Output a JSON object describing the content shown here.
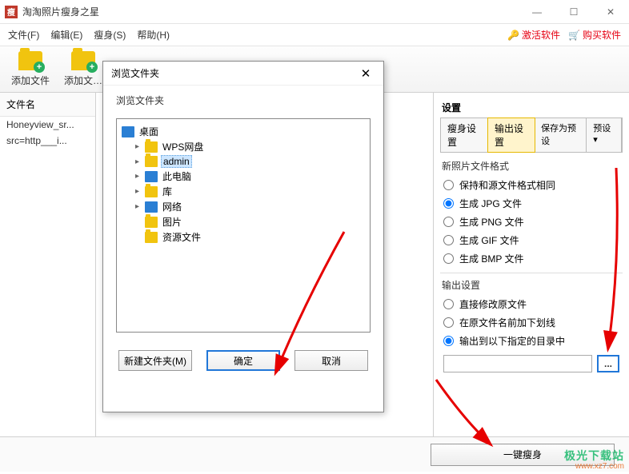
{
  "window": {
    "title": "淘淘照片瘦身之星"
  },
  "win_controls": {
    "min": "—",
    "max": "☐",
    "close": "✕"
  },
  "menu": {
    "file": "文件(F)",
    "edit": "编辑(E)",
    "slim": "瘦身(S)",
    "help": "帮助(H)",
    "activate": "激活软件",
    "buy": "购买软件"
  },
  "toolbar": {
    "add_file": "添加文件",
    "add_folder": "添加文…"
  },
  "file_list": {
    "header": "文件名",
    "items": [
      "Honeyview_sr...",
      "src=http___i..."
    ]
  },
  "settings": {
    "title": "设置",
    "tabs": {
      "slim": "瘦身设置",
      "output": "输出设置",
      "save_preset": "保存为预设",
      "preset": "预设 ▾"
    },
    "format_group": "新照片文件格式",
    "format_opts": {
      "same": "保持和源文件格式相同",
      "jpg": "生成 JPG 文件",
      "png": "生成 PNG 文件",
      "gif": "生成 GIF 文件",
      "bmp": "生成 BMP 文件"
    },
    "output_group": "输出设置",
    "output_opts": {
      "overwrite": "直接修改原文件",
      "underscore": "在原文件名前加下划线",
      "todir": "输出到以下指定的目录中"
    },
    "path_value": "",
    "browse_label": "..."
  },
  "bottom": {
    "run": "一键瘦身"
  },
  "dialog": {
    "title": "浏览文件夹",
    "subtitle": "浏览文件夹",
    "tree": {
      "root": "桌面",
      "items": [
        {
          "label": "WPS网盘",
          "icon": "folder"
        },
        {
          "label": "admin",
          "icon": "folder",
          "selected": true
        },
        {
          "label": "此电脑",
          "icon": "monitor"
        },
        {
          "label": "库",
          "icon": "folder"
        },
        {
          "label": "网络",
          "icon": "monitor"
        },
        {
          "label": "图片",
          "icon": "folder",
          "noexpand": true
        },
        {
          "label": "资源文件",
          "icon": "folder",
          "noexpand": true
        }
      ]
    },
    "buttons": {
      "newfolder": "新建文件夹(M)",
      "ok": "确定",
      "cancel": "取消"
    }
  },
  "watermark": {
    "line1": "极光下载站",
    "line2": "www.xz7.com"
  }
}
